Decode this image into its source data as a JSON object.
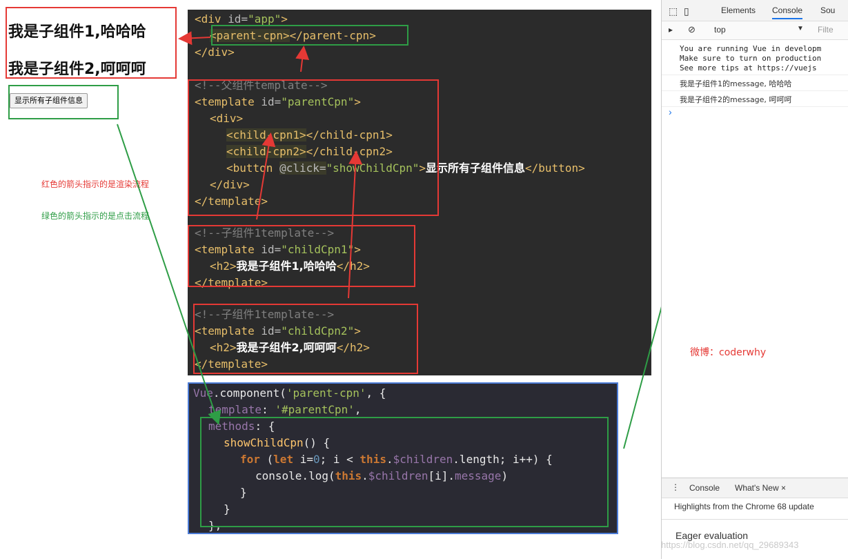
{
  "preview": {
    "child1": "我是子组件1,哈哈哈",
    "child2": "我是子组件2,呵呵呵",
    "button": "显示所有子组件信息"
  },
  "notes": {
    "red": "红色的箭头指示的是渲染流程",
    "green": "绿色的箭头指示的是点击流程",
    "weibo": "微博：coderwhy"
  },
  "code_top": {
    "l1": [
      "<div ",
      "id=",
      "\"app\"",
      ">"
    ],
    "l2": [
      "<parent-cpn>",
      "</parent-cpn>"
    ],
    "l3": "</div>",
    "c1": "<!--父组件template-->",
    "t1": [
      "<template ",
      "id=",
      "\"parentCpn\"",
      ">"
    ],
    "d1": "<div>",
    "cc1": [
      "<child-cpn1>",
      "</child-cpn1>"
    ],
    "cc2": [
      "<child-cpn2>",
      "</child-cpn2>"
    ],
    "btn": [
      "<button ",
      "@click=",
      "\"showChildCpn\"",
      ">",
      "显示所有子组件信息",
      "</button>"
    ],
    "d2": "</div>",
    "te1": "</template>",
    "c2": "<!--子组件1template-->",
    "t2": [
      "<template ",
      "id=",
      "\"childCpn1\"",
      ">"
    ],
    "h1": [
      "<h2>",
      "我是子组件1,哈哈哈",
      "</h2>"
    ],
    "te2": "</template>",
    "c3": "<!--子组件1template-->",
    "t3": [
      "<template ",
      "id=",
      "\"childCpn2\"",
      ">"
    ],
    "h2": [
      "<h2>",
      "我是子组件2,呵呵呵",
      "</h2>"
    ],
    "te3": "</template>"
  },
  "code_bottom": {
    "b1": [
      "Vue",
      ".component(",
      "'parent-cpn'",
      ", {"
    ],
    "b2": [
      "template",
      ": ",
      "'#parentCpn'",
      ","
    ],
    "b3": [
      "methods",
      ": {"
    ],
    "b4": [
      "showChildCpn",
      "() {"
    ],
    "b5": [
      "for",
      " (",
      "let",
      " i=",
      "0",
      "; i < ",
      "this",
      ".",
      "$children",
      ".length; i++) {"
    ],
    "b6": [
      "console.log(",
      "this",
      ".",
      "$children",
      "[i].",
      "message",
      ")"
    ],
    "b7": "}",
    "b8": "}",
    "b9": "},"
  },
  "devtools": {
    "tabs": [
      "Elements",
      "Console",
      "Sou"
    ],
    "context": "top",
    "filter_placeholder": "Filte",
    "warn": "You are running Vue in developm\nMake sure to turn on production\nSee more tips at https://vuejs",
    "log1": "我是子组件1的message, 哈哈哈",
    "log2": "我是子组件2的message, 呵呵呵",
    "prompt": "›",
    "drawer_tabs": [
      "Console",
      "What's New ×"
    ],
    "highlights": "Highlights from the Chrome 68 update",
    "eager": "Eager evaluation"
  },
  "watermark": "https://blog.csdn.net/qq_29689343",
  "colors": {
    "red": "#e53935",
    "green": "#2e9d46",
    "code_bg": "#2b2b2b"
  }
}
